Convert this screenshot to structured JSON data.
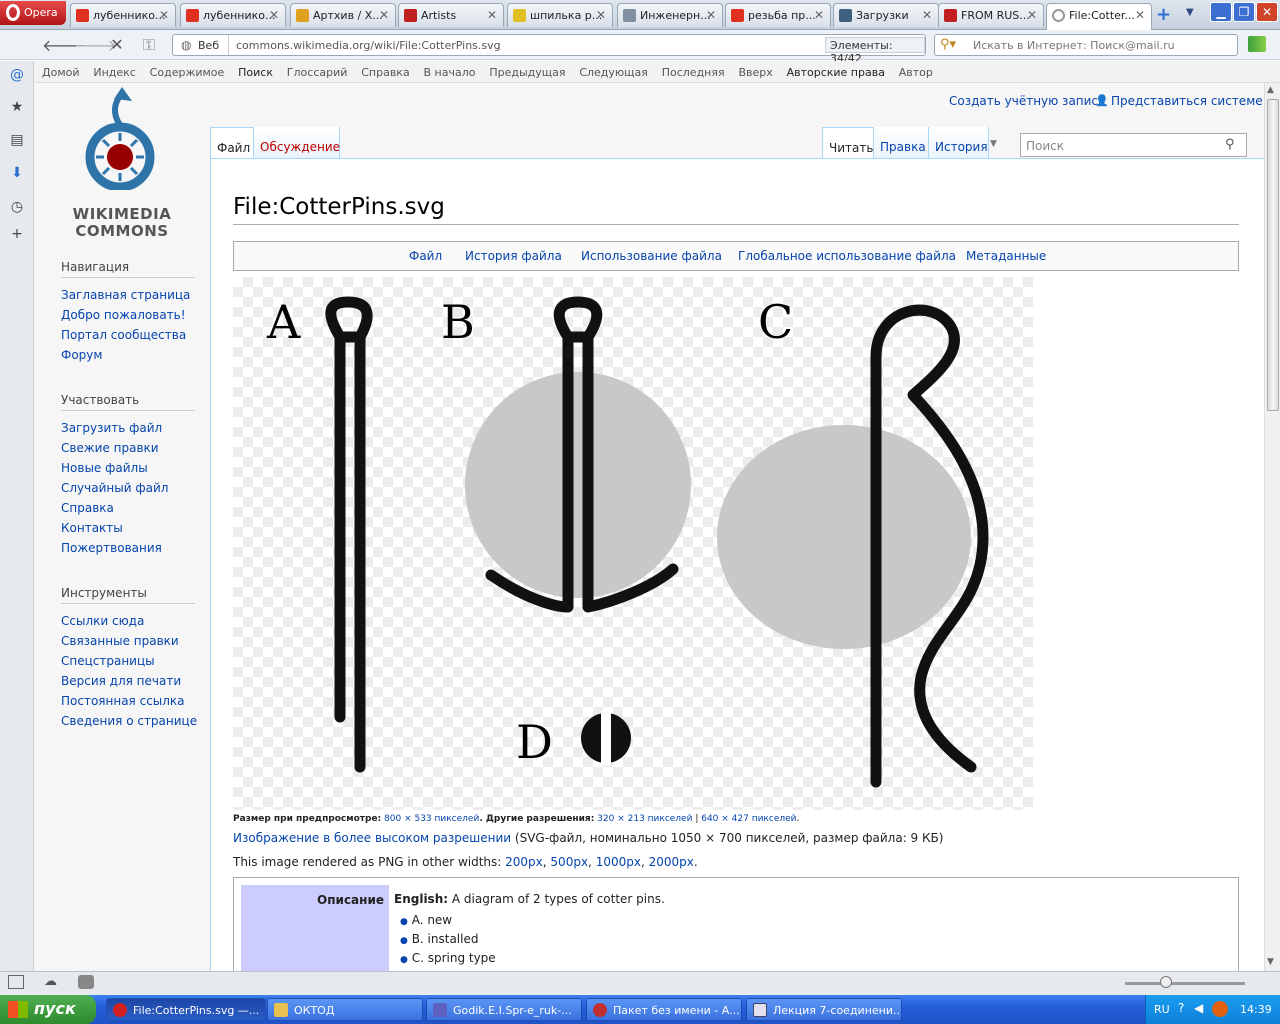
{
  "browser": {
    "menu_label": "Opera",
    "tabs": [
      {
        "title": "лубеннико...",
        "color": "#e03020"
      },
      {
        "title": "лубеннико...",
        "color": "#e03020"
      },
      {
        "title": "Артхив / Х...",
        "color": "#e0a020"
      },
      {
        "title": "Artists",
        "color": "#c02020"
      },
      {
        "title": "шпилька р...",
        "color": "#e0c020"
      },
      {
        "title": "Инженерн...",
        "color": "#8090a0"
      },
      {
        "title": "резьба пр...",
        "color": "#e03020"
      },
      {
        "title": "Загрузки",
        "color": "#406080"
      },
      {
        "title": "FROM RUS...",
        "color": "#c02020"
      },
      {
        "title": "File:Cotter...",
        "color": "#999999"
      }
    ],
    "address_prefix": "Веб",
    "url": "commons.wikimedia.org/wiki/File:CotterPins.svg",
    "elements_label": "Элементы:",
    "elements_count": "34/42",
    "search_placeholder": "Искать в Интернет: Поиск@mail.ru",
    "navbar": [
      "Домой",
      "Индекс",
      "Содержимое",
      "Поиск",
      "Глоссарий",
      "Справка",
      "В начало",
      "Предыдущая",
      "Следующая",
      "Последняя",
      "Вверх",
      "Авторские права",
      "Автор"
    ]
  },
  "wiki": {
    "logo_line1": "WIKIMEDIA",
    "logo_line2": "COMMONS",
    "create_account": "Создать учётную запись",
    "login": "Представиться системе",
    "tabs_left": [
      "Файл",
      "Обсуждение"
    ],
    "tabs_right": [
      "Читать",
      "Правка",
      "История"
    ],
    "search_placeholder": "Поиск",
    "page_title": "File:CotterPins.svg",
    "file_toc": [
      "Файл",
      "История файла",
      "Использование файла",
      "Глобальное использование файла",
      "Метаданные"
    ],
    "sidebar": {
      "nav_head": "Навигация",
      "nav": [
        "Заглавная страница",
        "Добро пожаловать!",
        "Портал сообщества",
        "Форум"
      ],
      "part_head": "Участвовать",
      "part": [
        "Загрузить файл",
        "Свежие правки",
        "Новые файлы",
        "Случайный файл",
        "Справка",
        "Контакты",
        "Пожертвования"
      ],
      "tools_head": "Инструменты",
      "tools": [
        "Ссылки сюда",
        "Связанные правки",
        "Спецстраницы",
        "Версия для печати",
        "Постоянная ссылка",
        "Сведения о странице"
      ]
    },
    "image_labels": [
      "A",
      "B",
      "C",
      "D"
    ],
    "preview_label": "Размер при предпросмотре:",
    "preview_size": "800 × 533 пикселей",
    "other_res_label": ". Другие разрешения:",
    "res1": "320 × 213 пикселей",
    "res2": "640 × 427 пикселей",
    "hires_link": "Изображение в более высоком разрешении",
    "hires_info": "(SVG-файл, номинально 1050 × 700 пикселей, размер файла: 9 КБ)",
    "png_text": "This image rendered as PNG in other widths:",
    "png_widths": [
      "200px",
      "500px",
      "1000px",
      "2000px"
    ],
    "desc_label": "Описание",
    "desc_lang": "English:",
    "desc_text": "A diagram of 2 types of cotter pins.",
    "desc_items": [
      "A. new",
      "B. installed",
      "C. spring type"
    ]
  },
  "taskbar": {
    "start": "пуск",
    "tasks": [
      "File:CotterPins.svg —...",
      "ОКТОД",
      "Godik.E.I.Spr-e_ruk-...",
      "Пакет без имени - А...",
      "Лекция 7-соединени..."
    ],
    "lang": "RU",
    "time": "14:39"
  }
}
